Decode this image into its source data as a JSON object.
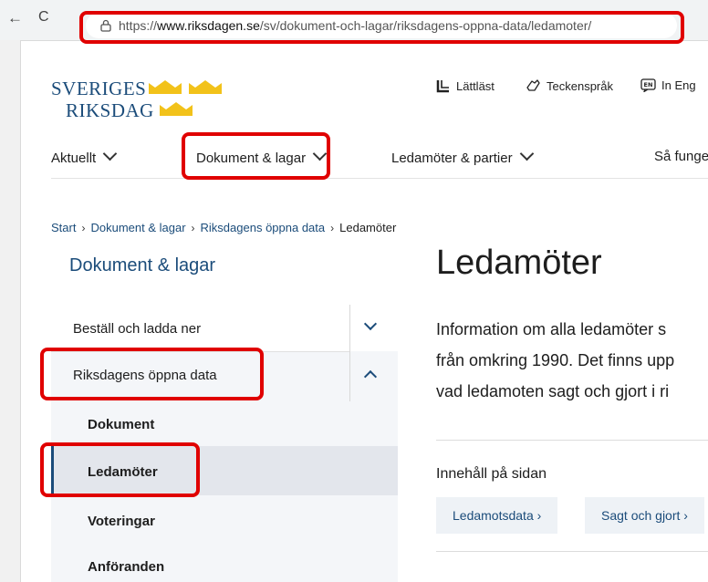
{
  "browser": {
    "back_label": "←",
    "reload_label": "C",
    "url_prefix": "https://",
    "url_host": "www.riksdagen.se",
    "url_path": "/sv/dokument-och-lagar/riksdagens-oppna-data/ledamoter/"
  },
  "logo": {
    "line1": "SVERIGES",
    "line2": "RIKSDAG",
    "color": "#1b4c7a",
    "crown_color": "#f2c21a"
  },
  "utility": {
    "easy_read": "Lättläst",
    "sign_language": "Teckenspråk",
    "english": "In Eng"
  },
  "mainnav": {
    "items": [
      {
        "label": "Aktuellt"
      },
      {
        "label": "Dokument & lagar"
      },
      {
        "label": "Ledamöter & partier"
      },
      {
        "label": "Så funge"
      }
    ]
  },
  "breadcrumb": {
    "items": [
      "Start",
      "Dokument & lagar",
      "Riksdagens öppna data"
    ],
    "current": "Ledamöter",
    "separator": "›"
  },
  "sidebar": {
    "title": "Dokument & lagar",
    "items": [
      {
        "label": "Beställ och ladda ner"
      },
      {
        "label": "Riksdagens öppna data"
      }
    ],
    "subitems": [
      {
        "label": "Dokument"
      },
      {
        "label": "Ledamöter",
        "active": true
      },
      {
        "label": "Voteringar"
      },
      {
        "label": "Anföranden"
      }
    ]
  },
  "content": {
    "title": "Ledamöter",
    "lead_lines": [
      "Information om alla ledamöter s",
      "från omkring 1990. Det finns upp",
      "vad ledamoten sagt och gjort i ri"
    ],
    "toc_title": "Innehåll på sidan",
    "toc_buttons": [
      {
        "label": "Ledamotsdata ›"
      },
      {
        "label": "Sagt och gjort ›"
      }
    ]
  },
  "colors": {
    "accent": "#1b4c7a",
    "highlight": "#e00000"
  }
}
